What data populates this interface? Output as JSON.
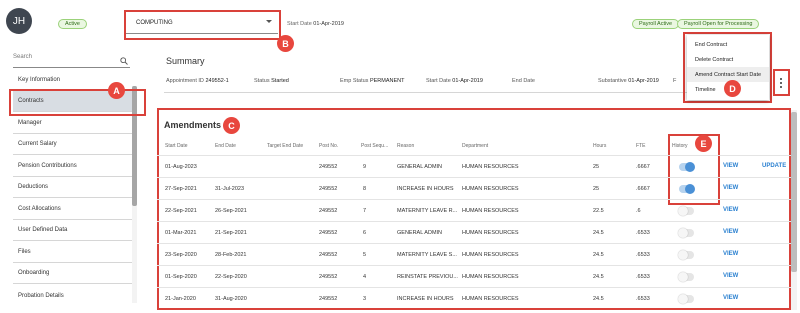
{
  "header": {
    "avatar_initials": "JH",
    "status_badge": "Active",
    "department_select": "COMPUTING",
    "start_date_label": "Start Date",
    "start_date_value": "01-Apr-2019",
    "payroll_badge": "Payroll Active",
    "payroll_open_badge": "Payroll Open for Processing"
  },
  "sidebar": {
    "search_placeholder": "Search",
    "items": [
      {
        "label": "Key Information"
      },
      {
        "label": "Contracts"
      },
      {
        "label": "Manager"
      },
      {
        "label": "Current Salary"
      },
      {
        "label": "Pension Contributions"
      },
      {
        "label": "Deductions"
      },
      {
        "label": "Cost Allocations"
      },
      {
        "label": "User Defined Data"
      },
      {
        "label": "Files"
      },
      {
        "label": "Onboarding"
      },
      {
        "label": "Probation Details"
      }
    ]
  },
  "summary": {
    "title": "Summary",
    "appointment_id_label": "Appointment ID",
    "appointment_id_value": "249552-1",
    "status_label": "Status",
    "status_value": "Started",
    "emp_status_label": "Emp Status",
    "emp_status_value": "PERMANENT",
    "start_date_label": "Start Date",
    "start_date_value": "01-Apr-2019",
    "end_date_label": "End Date",
    "substantive_label": "Substantive",
    "substantive_value": "01-Apr-2019",
    "truncated": "F"
  },
  "menu": {
    "items": [
      {
        "label": "End Contract"
      },
      {
        "label": "Delete Contract"
      },
      {
        "label": "Amend Contract Start Date"
      },
      {
        "label": "Timeline"
      }
    ]
  },
  "amendments": {
    "title": "Amendments",
    "columns": [
      "Start Date",
      "End Date",
      "Target End Date",
      "Post No.",
      "Post Sequ...",
      "Reason",
      "Department",
      "Hours",
      "FTE",
      "History"
    ],
    "rows": [
      {
        "start": "01-Aug-2023",
        "end": "",
        "target": "",
        "post": "249552",
        "seq": "9",
        "reason": "GENERAL ADMIN",
        "dept": "HUMAN RESOURCES",
        "hours": "25",
        "fte": ".6667",
        "history": true,
        "view": "VIEW",
        "update": "UPDATE"
      },
      {
        "start": "27-Sep-2021",
        "end": "31-Jul-2023",
        "target": "",
        "post": "249552",
        "seq": "8",
        "reason": "INCREASE IN HOURS",
        "dept": "HUMAN RESOURCES",
        "hours": "25",
        "fte": ".6667",
        "history": true,
        "view": "VIEW",
        "update": ""
      },
      {
        "start": "22-Sep-2021",
        "end": "26-Sep-2021",
        "target": "",
        "post": "249552",
        "seq": "7",
        "reason": "MATERNITY LEAVE R...",
        "dept": "HUMAN RESOURCES",
        "hours": "22.5",
        "fte": ".6",
        "history": false,
        "view": "VIEW",
        "update": ""
      },
      {
        "start": "01-Mar-2021",
        "end": "21-Sep-2021",
        "target": "",
        "post": "249552",
        "seq": "6",
        "reason": "GENERAL ADMIN",
        "dept": "HUMAN RESOURCES",
        "hours": "24.5",
        "fte": ".6533",
        "history": false,
        "view": "VIEW",
        "update": ""
      },
      {
        "start": "23-Sep-2020",
        "end": "28-Feb-2021",
        "target": "",
        "post": "249552",
        "seq": "5",
        "reason": "MATERNITY LEAVE S...",
        "dept": "HUMAN RESOURCES",
        "hours": "24.5",
        "fte": ".6533",
        "history": false,
        "view": "VIEW",
        "update": ""
      },
      {
        "start": "01-Sep-2020",
        "end": "22-Sep-2020",
        "target": "",
        "post": "249552",
        "seq": "4",
        "reason": "REINSTATE PREVIOU...",
        "dept": "HUMAN RESOURCES",
        "hours": "24.5",
        "fte": ".6533",
        "history": false,
        "view": "VIEW",
        "update": ""
      },
      {
        "start": "21-Jan-2020",
        "end": "31-Aug-2020",
        "target": "",
        "post": "249552",
        "seq": "3",
        "reason": "INCREASE IN HOURS",
        "dept": "HUMAN RESOURCES",
        "hours": "24.5",
        "fte": ".6533",
        "history": false,
        "view": "VIEW",
        "update": ""
      }
    ]
  },
  "annotations": [
    "A",
    "B",
    "C",
    "D",
    "E"
  ],
  "colors": {
    "annotation_red": "#d9413a",
    "link_blue": "#2a80d0",
    "badge_green": "#eaf7e1"
  }
}
